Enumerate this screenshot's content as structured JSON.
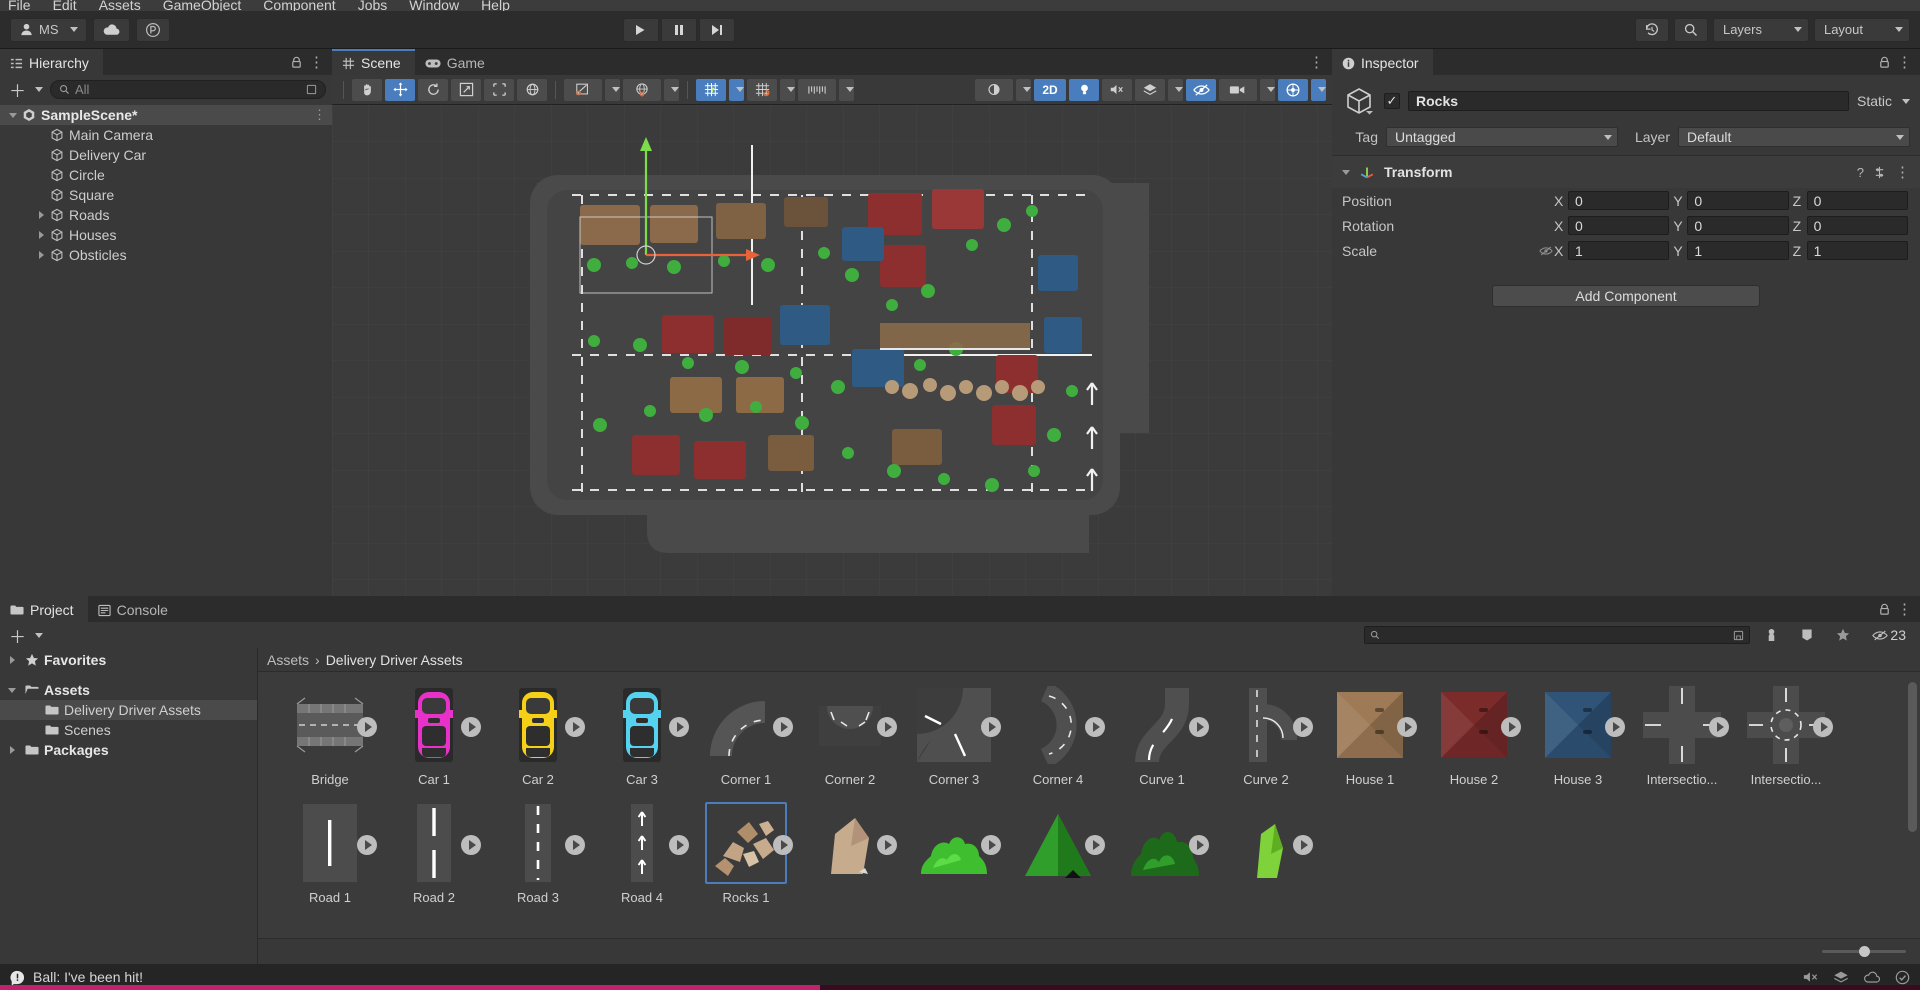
{
  "menu": {
    "items": [
      "File",
      "Edit",
      "Assets",
      "GameObject",
      "Component",
      "Jobs",
      "Window",
      "Help"
    ]
  },
  "toolbar": {
    "account_label": "MS",
    "account_icon": "person-icon",
    "cloud_icon": "cloud-icon",
    "services_icon": "services-icon",
    "play_icon": "play-icon",
    "pause_icon": "pause-icon",
    "step_icon": "step-icon",
    "history_icon": "undo-history-icon",
    "search_icon": "search-icon",
    "layers_label": "Layers",
    "layout_label": "Layout"
  },
  "hierarchy": {
    "tab_label": "Hierarchy",
    "tab_icon": "hierarchy-icon",
    "lock_icon": "lock-icon",
    "kebab_icon": "kebab-menu-icon",
    "add_icon": "plus-icon",
    "search_placeholder": "All",
    "search_value": "",
    "search_icon": "search-icon",
    "filter_icon": "filter-icon",
    "items": [
      {
        "label": "SampleScene*",
        "depth": 0,
        "icon": "unity-scene-icon",
        "expanded": true,
        "selected": true,
        "has_children": true
      },
      {
        "label": "Main Camera",
        "depth": 2,
        "icon": "gameobject-cube-icon",
        "expanded": false,
        "selected": false,
        "has_children": false
      },
      {
        "label": "Delivery Car",
        "depth": 2,
        "icon": "gameobject-cube-icon",
        "expanded": false,
        "selected": false,
        "has_children": false
      },
      {
        "label": "Circle",
        "depth": 2,
        "icon": "gameobject-cube-icon",
        "expanded": false,
        "selected": false,
        "has_children": false
      },
      {
        "label": "Square",
        "depth": 2,
        "icon": "gameobject-cube-icon",
        "expanded": false,
        "selected": false,
        "has_children": false
      },
      {
        "label": "Roads",
        "depth": 2,
        "icon": "gameobject-cube-icon",
        "expanded": false,
        "selected": false,
        "has_children": true
      },
      {
        "label": "Houses",
        "depth": 2,
        "icon": "gameobject-cube-icon",
        "expanded": false,
        "selected": false,
        "has_children": true
      },
      {
        "label": "Obsticles",
        "depth": 2,
        "icon": "gameobject-cube-icon",
        "expanded": false,
        "selected": false,
        "has_children": true
      }
    ]
  },
  "scene": {
    "tabs": [
      {
        "label": "Scene",
        "icon": "scene-grid-icon",
        "active": true
      },
      {
        "label": "Game",
        "icon": "gamepad-icon",
        "active": false
      }
    ],
    "kebab_icon": "kebab-menu-icon",
    "tools": [
      {
        "name": "hand-tool",
        "active": false
      },
      {
        "name": "move-tool",
        "active": true
      },
      {
        "name": "rotate-tool",
        "active": false
      },
      {
        "name": "scale-tool",
        "active": false
      },
      {
        "name": "rect-tool",
        "active": false
      },
      {
        "name": "transform-tool",
        "active": false
      }
    ],
    "pivot_label": "pivot-center-toggle",
    "handle_label": "global-local-toggle",
    "mode_2d": "2D",
    "grid_icon": "grid-visibility-icon",
    "snap_icon": "grid-snap-icon",
    "ruler_icon": "ruler-icon",
    "audio_icon": "audio-mute-icon",
    "fx_icon": "effects-icon",
    "visibility_icon": "scene-visibility-icon",
    "camera_icon": "scene-camera-icon",
    "gizmos_icon": "gizmos-icon"
  },
  "inspector": {
    "tab_label": "Inspector",
    "tab_icon": "info-icon",
    "lock_icon": "lock-icon",
    "kebab_icon": "kebab-menu-icon",
    "object_icon": "gameobject-cube-icon",
    "enabled": true,
    "object_name": "Rocks",
    "static_label": "Static",
    "tag_label": "Tag",
    "tag_value": "Untagged",
    "layer_label": "Layer",
    "layer_value": "Default",
    "transform": {
      "title": "Transform",
      "icon": "transform-axis-icon",
      "help_icon": "help-icon",
      "preset_icon": "preset-icon",
      "kebab_icon": "kebab-menu-icon",
      "rows": [
        {
          "label": "Position",
          "x": "0",
          "y": "0",
          "z": "0",
          "locked": false
        },
        {
          "label": "Rotation",
          "x": "0",
          "y": "0",
          "z": "0",
          "locked": false
        },
        {
          "label": "Scale",
          "x": "1",
          "y": "1",
          "z": "1",
          "locked": true
        }
      ],
      "axis_labels": [
        "X",
        "Y",
        "Z"
      ]
    },
    "add_component_label": "Add Component"
  },
  "project": {
    "tabs": [
      {
        "label": "Project",
        "icon": "folder-icon",
        "active": true
      },
      {
        "label": "Console",
        "icon": "console-icon",
        "active": false
      }
    ],
    "lock_icon": "lock-icon",
    "kebab_icon": "kebab-menu-icon",
    "add_icon": "plus-icon",
    "search_placeholder": "",
    "search_value": "",
    "search_icon": "search-icon",
    "filter_icons": [
      "save-search-icon",
      "filter-by-type-icon",
      "filter-by-label-icon",
      "favorite-star-icon"
    ],
    "hidden_count": "23",
    "hidden_icon": "hidden-assets-icon",
    "tree": [
      {
        "label": "Favorites",
        "depth": 0,
        "icon": "star-icon",
        "expanded": false,
        "selected": false,
        "has_children": true,
        "bold": true
      },
      {
        "label": "Assets",
        "depth": 0,
        "icon": "folder-open-icon",
        "expanded": true,
        "selected": false,
        "has_children": true,
        "bold": true
      },
      {
        "label": "Delivery Driver Assets",
        "depth": 1,
        "icon": "folder-icon",
        "expanded": false,
        "selected": true,
        "has_children": false,
        "bold": false
      },
      {
        "label": "Scenes",
        "depth": 1,
        "icon": "folder-icon",
        "expanded": false,
        "selected": false,
        "has_children": false,
        "bold": false
      },
      {
        "label": "Packages",
        "depth": 0,
        "icon": "folder-icon",
        "expanded": false,
        "selected": false,
        "has_children": true,
        "bold": true
      }
    ],
    "breadcrumb": [
      "Assets",
      "Delivery Driver Assets"
    ],
    "assets": [
      {
        "label": "Bridge",
        "kind": "bridge",
        "selected": false
      },
      {
        "label": "Car 1",
        "kind": "car",
        "color": "#e831c8",
        "selected": false
      },
      {
        "label": "Car 2",
        "kind": "car",
        "color": "#f5cf18",
        "selected": false
      },
      {
        "label": "Car 3",
        "kind": "car",
        "color": "#54d2f0",
        "selected": false
      },
      {
        "label": "Corner 1",
        "kind": "corner1",
        "selected": false
      },
      {
        "label": "Corner 2",
        "kind": "corner2",
        "selected": false
      },
      {
        "label": "Corner 3",
        "kind": "corner3",
        "selected": false
      },
      {
        "label": "Corner 4",
        "kind": "corner4",
        "selected": false
      },
      {
        "label": "Curve 1",
        "kind": "curve1",
        "selected": false
      },
      {
        "label": "Curve 2",
        "kind": "curve2",
        "selected": false
      },
      {
        "label": "House 1",
        "kind": "house",
        "color": "#9e7a56",
        "selected": false
      },
      {
        "label": "House 2",
        "kind": "house",
        "color": "#7c2b2b",
        "selected": false
      },
      {
        "label": "House 3",
        "kind": "house",
        "color": "#2f5478",
        "selected": false
      },
      {
        "label": "Intersectio...",
        "kind": "intersection1",
        "selected": false
      },
      {
        "label": "Intersectio...",
        "kind": "intersection2",
        "selected": false
      },
      {
        "label": "Road 1",
        "kind": "road1",
        "selected": false
      },
      {
        "label": "Road 2",
        "kind": "road2",
        "selected": false
      },
      {
        "label": "Road 3",
        "kind": "road3",
        "selected": false
      },
      {
        "label": "Road 4",
        "kind": "road4",
        "selected": false
      },
      {
        "label": "Rocks 1",
        "kind": "rocks",
        "selected": true
      },
      {
        "label": "",
        "kind": "rock-single",
        "selected": false
      },
      {
        "label": "",
        "kind": "bush",
        "selected": false
      },
      {
        "label": "",
        "kind": "tree-cone",
        "selected": false
      },
      {
        "label": "",
        "kind": "tree-dark",
        "selected": false
      },
      {
        "label": "",
        "kind": "tree-light",
        "selected": false
      }
    ],
    "zoom_slider_value": 48
  },
  "status": {
    "icon": "console-error-icon",
    "message": "Ball: I've been hit!",
    "right_icons": [
      "mute-audio-icon",
      "layers-status-icon",
      "cloud-status-icon",
      "check-status-icon"
    ]
  }
}
